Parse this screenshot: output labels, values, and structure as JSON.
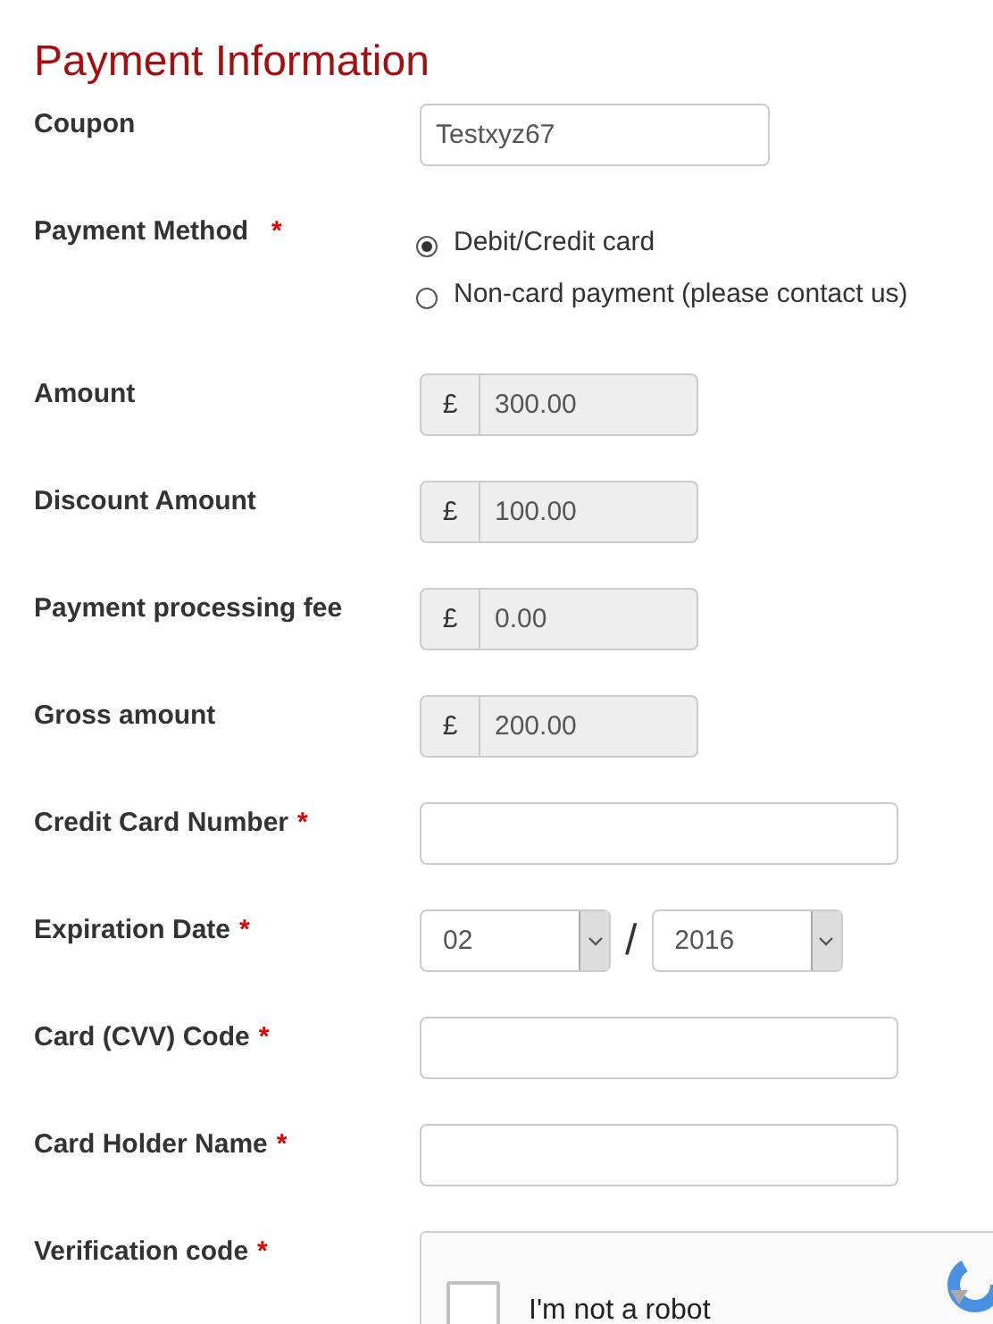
{
  "title": "Payment Information",
  "fields": [
    {
      "kind": "text",
      "label": "Coupon",
      "value": "Testxyz67"
    },
    {
      "kind": "radio",
      "label": "Payment Method",
      "required_mark": "*",
      "options": [
        {
          "label": "Debit/Credit card",
          "selected": true
        },
        {
          "label": "Non-card payment (please contact us)",
          "selected": false
        }
      ]
    },
    {
      "kind": "currency",
      "label": "Amount",
      "symbol": "£",
      "value": "300.00",
      "disabled": true
    },
    {
      "kind": "currency",
      "label": "Discount Amount",
      "symbol": "£",
      "value": "100.00",
      "disabled": true
    },
    {
      "kind": "currency",
      "label": "Payment processing fee",
      "symbol": "£",
      "value": "0.00",
      "disabled": true
    },
    {
      "kind": "currency",
      "label": "Gross amount",
      "symbol": "£",
      "value": "200.00",
      "disabled": true
    },
    {
      "kind": "text",
      "label": "Credit Card Number",
      "required_mark": "*"
    },
    {
      "kind": "date",
      "label": "Expiration Date",
      "required_mark": "*",
      "month": "02",
      "separator": "/",
      "year": "2016"
    },
    {
      "kind": "text",
      "label": "Card (CVV) Code",
      "required_mark": "*"
    },
    {
      "kind": "text",
      "label": "Card Holder Name",
      "required_mark": "*"
    },
    {
      "kind": "captcha",
      "label": "Verification code",
      "required_mark": "*",
      "text": "I'm not a robot",
      "checked": false
    }
  ]
}
